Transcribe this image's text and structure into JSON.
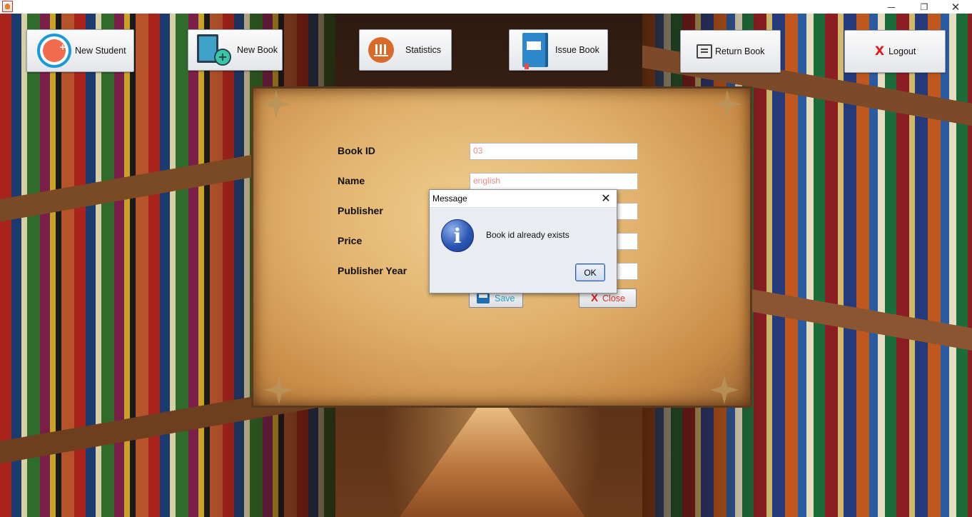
{
  "window": {
    "minimize_glyph": "—",
    "maximize_glyph": "❐",
    "close_glyph": "✕"
  },
  "toolbar": {
    "new_student": {
      "label": "New Student",
      "icon": "add-user-icon"
    },
    "new_book": {
      "label": "New Book",
      "icon": "add-book-icon"
    },
    "statistics": {
      "label": "Statistics",
      "icon": "bar-chart-icon"
    },
    "issue_book": {
      "label": "Issue Book",
      "icon": "book-icon"
    },
    "return_book": {
      "label": "Return Book",
      "icon": "return-icon"
    },
    "logout": {
      "label": "Logout",
      "icon": "x-icon",
      "icon_glyph": "X"
    }
  },
  "form": {
    "fields": {
      "book_id": {
        "label": "Book ID",
        "value": "03"
      },
      "name": {
        "label": "Name",
        "value": "english"
      },
      "publisher": {
        "label": "Publisher",
        "value": ""
      },
      "price": {
        "label": "Price",
        "value": ""
      },
      "publisher_year": {
        "label": "Publisher Year",
        "value": ""
      }
    },
    "save_label": "Save",
    "close_label": "Close",
    "close_glyph": "X"
  },
  "dialog": {
    "title": "Message",
    "close_glyph": "✕",
    "icon_glyph": "i",
    "message": "Book id already exists",
    "ok_label": "OK"
  },
  "colors": {
    "input_text": "#e88a86",
    "save_text": "#27a3c4",
    "close_text": "#e03030",
    "dialog_bg": "#e9ecf1",
    "ok_border": "#2c5aa0"
  }
}
